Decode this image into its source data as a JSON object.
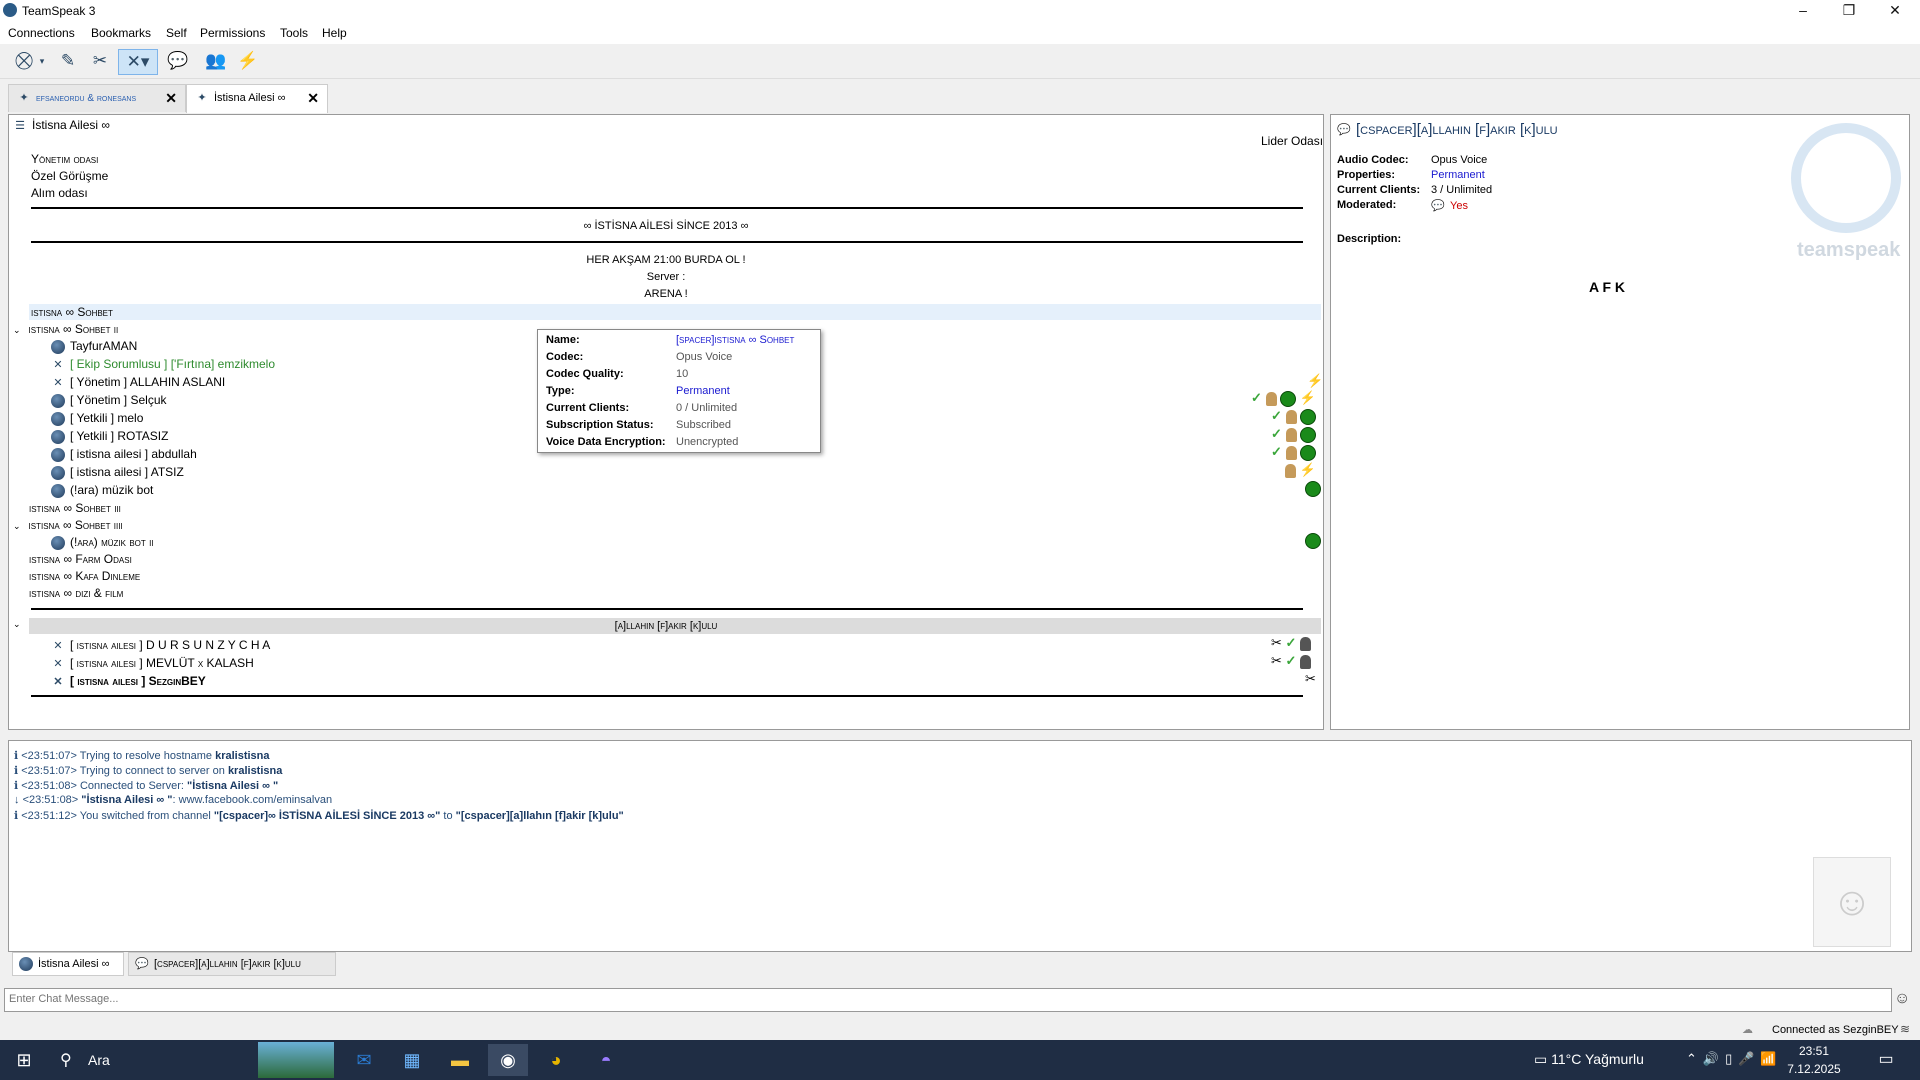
{
  "window": {
    "title": "TeamSpeak 3",
    "buttons": [
      "–",
      "❐",
      "✕"
    ]
  },
  "menu": [
    "Connections",
    "Bookmarks",
    "Self",
    "Permissions",
    "Tools",
    "Help"
  ],
  "tabs": [
    {
      "label": "efsaneordu & ronesans"
    },
    {
      "label": "İstisna Ailesi ∞"
    }
  ],
  "server": {
    "name": "İstisna Ailesi ∞",
    "lider": "Lider Odası"
  },
  "channels_top": [
    "Yönetim odası",
    "Özel Görüşme",
    "Alım odası"
  ],
  "spacer_title": "∞ İSTİSNA AİLESİ SİNCE 2013 ∞",
  "motd": [
    "HER AKŞAM 21:00 BURDA OL !",
    "Server :",
    "ARENA !"
  ],
  "channel_sohbet": "istisna ∞ Sohbet",
  "channel_sohbet2": "istisna ∞ Sohbet ii",
  "clients_sohbet2": [
    {
      "name": "TayfurAMAN",
      "color": "#000000"
    },
    {
      "name": "[ Ekip Sorumlusu ] ['Fırtına] emzikmelo",
      "color": "#2e8b2e"
    },
    {
      "name": "[ Yönetim ] ALLAHIN ASLANI",
      "color": "#000000"
    },
    {
      "name": "[ Yönetim ] Selçuk",
      "color": "#000000"
    },
    {
      "name": "[ Yetkili ] melo",
      "color": "#000000"
    },
    {
      "name": "[ Yetkili ] ROTASIZ",
      "color": "#000000"
    },
    {
      "name": "[ istisna ailesi ] abdullah",
      "color": "#000000"
    },
    {
      "name": "[ istisna ailesi ] ATSIZ",
      "color": "#000000"
    },
    {
      "name": "(!ara) müzik bot",
      "color": "#000000"
    }
  ],
  "channel_sohbet3": "istisna ∞ Sohbet iii",
  "channel_sohbet4": "istisna ∞ Sohbet iiii",
  "client_sohbet4": "(!ara) müzik bot ii",
  "channels_after": [
    "istisna ∞ Farm Odası",
    "istisna ∞ Kafa Dinleme",
    "istisna ∞ dizi & film"
  ],
  "current_channel": "[a]llahın [f]akir [k]ulu",
  "clients_current": [
    "[ istisna ailesi ] D U R S U N  Z Y C H A",
    "[ istisna ailesi ] MEVLÜT x KALASH",
    "[ istisna ailesi ] SezginBEY"
  ],
  "tooltip": {
    "rows": [
      {
        "k": "Name:",
        "v": "[spacer]istisna ∞ Sohbet",
        "color": "#1a1ad0"
      },
      {
        "k": "Codec:",
        "v": "Opus Voice"
      },
      {
        "k": "Codec Quality:",
        "v": "10"
      },
      {
        "k": "Type:",
        "v": "Permanent",
        "color": "#1a1ad0"
      },
      {
        "k": "Current Clients:",
        "v": "0 / Unlimited"
      },
      {
        "k": "Subscription Status:",
        "v": "Subscribed"
      },
      {
        "k": "Voice Data Encryption:",
        "v": "Unencrypted"
      }
    ]
  },
  "info": {
    "title": "[cspacer][a]llahın [f]akir [k]ulu",
    "rows": [
      {
        "k": "Audio Codec:",
        "v": "Opus Voice"
      },
      {
        "k": "Properties:",
        "v": "Permanent",
        "color": "#1a1ad0"
      },
      {
        "k": "Current Clients:",
        "v": "3 / Unlimited"
      },
      {
        "k": "Moderated:",
        "v": "Yes",
        "color": "#cc0000"
      }
    ],
    "description_label": "Description:",
    "description": "A F K",
    "watermark": "teamspeak"
  },
  "log": [
    {
      "t": "<23:51:07> Trying to resolve hostname ",
      "b": "kralistisna",
      "rest": ""
    },
    {
      "t": "<23:51:07> Trying to connect to server on ",
      "b": "kralistisna",
      "rest": ""
    },
    {
      "t": "<23:51:08> Connected to Server: ",
      "b": "\"İstisna Ailesi ∞ \"",
      "rest": ""
    },
    {
      "t": "<23:51:08> ",
      "b": "\"İstisna Ailesi ∞ \"",
      "rest": ": www.facebook.com/eminsalvan"
    },
    {
      "t": "<23:51:12> You switched from channel ",
      "b": "\"[cspacer]∞ İSTİSNA AİLESİ SİNCE 2013 ∞\"",
      "rest": " to ",
      "b2": "\"[cspacer][a]llahın [f]akir [k]ulu\""
    }
  ],
  "bottom_tabs": [
    "İstisna Ailesi ∞",
    "[cspacer][a]llahın [f]akir [k]ulu"
  ],
  "chat_placeholder": "Enter Chat Message...",
  "status": "Connected as SezginBEY",
  "taskbar": {
    "search": "Ara",
    "weather": "11°C  Yağmurlu",
    "time": "23:51",
    "date": "7.12.2025"
  }
}
